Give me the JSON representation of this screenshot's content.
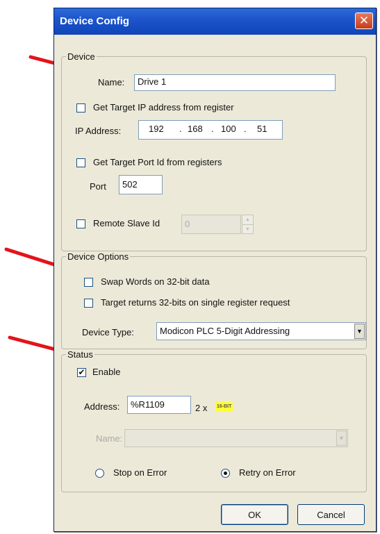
{
  "dialog": {
    "title": "Device Config",
    "close_glyph": "✕"
  },
  "device": {
    "legend": "Device",
    "name_label": "Name:",
    "name_value": "Drive 1",
    "get_ip_label": "Get Target IP address from register",
    "ip_label": "IP Address:",
    "ip_octets": [
      "192",
      "168",
      "100",
      "51"
    ],
    "get_port_label": "Get Target Port Id from registers",
    "port_label": "Port",
    "port_value": "502",
    "remote_slave_label": "Remote Slave Id",
    "remote_slave_value": "0"
  },
  "device_options": {
    "legend": "Device Options",
    "swap_words_label": "Swap Words on 32-bit data",
    "target_returns_label": "Target returns 32-bits on single register request",
    "device_type_label": "Device Type:",
    "device_type_value": "Modicon PLC 5-Digit Addressing"
  },
  "status": {
    "legend": "Status",
    "enable_label": "Enable",
    "enable_checked": true,
    "address_label": "Address:",
    "address_value": "%R1109",
    "multiplier": "2 x",
    "badge": "16-BIT",
    "name_label": "Name:",
    "stop_on_error_label": "Stop on Error",
    "retry_on_error_label": "Retry on Error",
    "selected_error_mode": "retry"
  },
  "buttons": {
    "ok": "OK",
    "cancel": "Cancel"
  },
  "colors": {
    "titlebar": "#1d55cc",
    "annotation_arrow": "#e3141a",
    "dialog_face": "#ece9d8"
  },
  "icons": {
    "close": "close-icon",
    "dropdown": "chevron-down-icon",
    "annotation": "red-arrow-icon"
  }
}
